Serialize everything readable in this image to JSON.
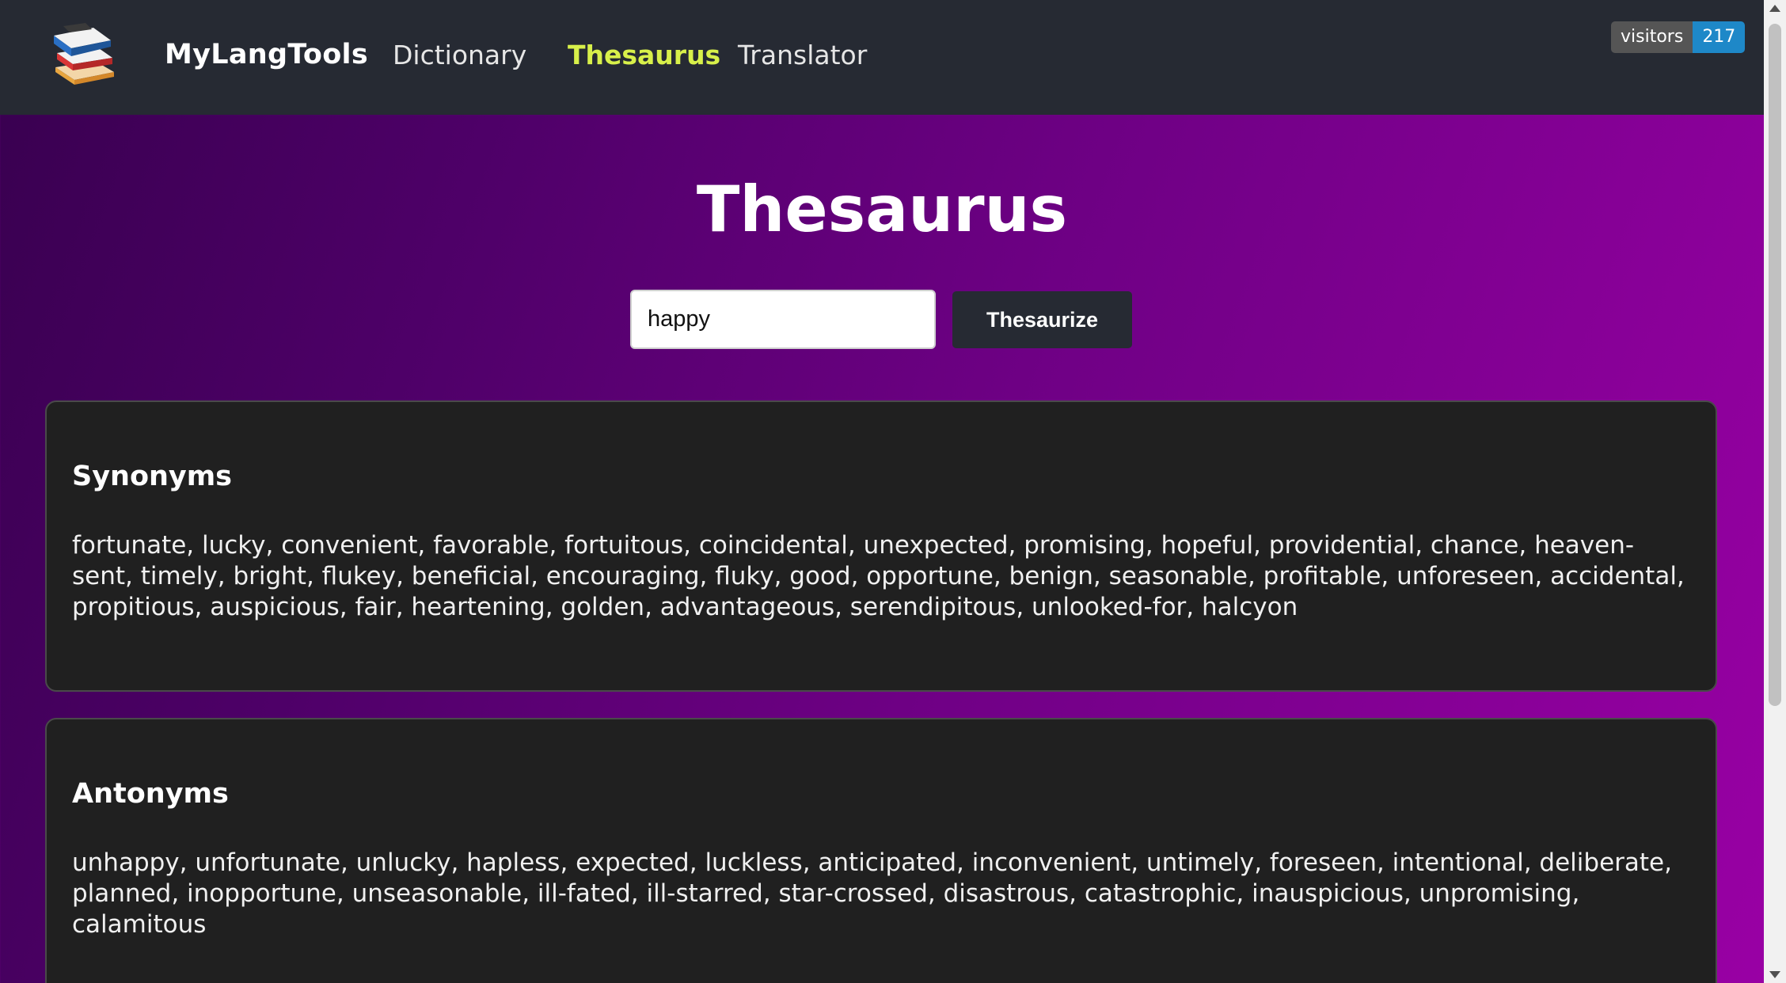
{
  "header": {
    "brand": "MyLangTools",
    "logo_icon": "books-stack-icon",
    "nav": [
      {
        "label": "Dictionary",
        "active": false
      },
      {
        "label": "Thesaurus",
        "active": true
      },
      {
        "label": "Translator",
        "active": false
      }
    ],
    "visitors_label": "visitors",
    "visitors_count": "217"
  },
  "main": {
    "title": "Thesaurus",
    "search_value": "happy",
    "button_label": "Thesaurize"
  },
  "synonyms": {
    "heading": "Synonyms",
    "text": "fortunate, lucky, convenient, favorable, fortuitous, coincidental, unexpected, promising, hopeful, providential, chance, heaven-sent, timely, bright, flukey, beneficial, encouraging, fluky, good, opportune, benign, seasonable, profitable, unforeseen, accidental, propitious, auspicious, fair, heartening, golden, advantageous, serendipitous, unlooked-for, halcyon"
  },
  "antonyms": {
    "heading": "Antonyms",
    "text": "unhappy, unfortunate, unlucky, hapless, expected, luckless, anticipated, inconvenient, untimely, foreseen, intentional, deliberate, planned, inopportune, unseasonable, ill-fated, ill-starred, star-crossed, disastrous, catastrophic, inauspicious, unpromising, calamitous"
  },
  "colors": {
    "navbar": "#262a33",
    "active_nav": "#d8f04a",
    "card_bg": "#202020",
    "badge_count": "#1e88c8"
  }
}
